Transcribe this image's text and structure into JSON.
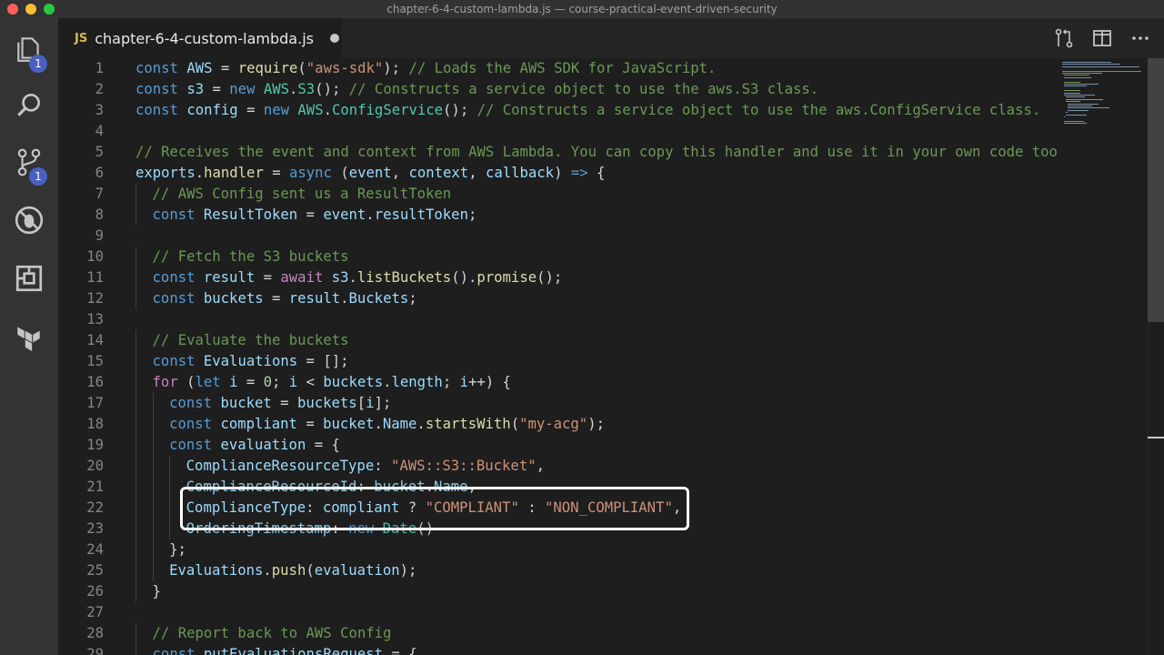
{
  "window": {
    "title": "chapter-6-4-custom-lambda.js — course-practical-event-driven-security"
  },
  "activity_bar": {
    "explorer_badge": "1",
    "source_control_badge": "1"
  },
  "tab": {
    "lang_badge": "JS",
    "filename": "chapter-6-4-custom-lambda.js"
  },
  "editor": {
    "line_numbers": [
      "1",
      "2",
      "3",
      "4",
      "5",
      "6",
      "7",
      "8",
      "9",
      "10",
      "11",
      "12",
      "13",
      "14",
      "15",
      "16",
      "17",
      "18",
      "19",
      "20",
      "21",
      "22",
      "23",
      "24",
      "25",
      "26",
      "27",
      "28",
      "29"
    ],
    "lines": [
      [
        "const",
        " ",
        "AWS",
        " = ",
        "require",
        "(",
        "\"aws-sdk\"",
        "); ",
        "// Loads the AWS SDK for JavaScript."
      ],
      [
        "const",
        " ",
        "s3",
        " = ",
        "new",
        " ",
        "AWS",
        ".",
        "S3",
        "(); ",
        "// Constructs a service object to use the aws.S3 class."
      ],
      [
        "const",
        " ",
        "config",
        " = ",
        "new",
        " ",
        "AWS",
        ".",
        "ConfigService",
        "(); ",
        "// Constructs a service object to use the aws.ConfigService class."
      ],
      [],
      [
        "// Receives the event and context from AWS Lambda. You can copy this handler and use it in your own code too!"
      ],
      [
        "exports",
        ".",
        "handler",
        " = ",
        "async",
        " (",
        "event",
        ", ",
        "context",
        ", ",
        "callback",
        ") ",
        "=>",
        " {"
      ],
      [
        "// AWS Config sent us a ResultToken"
      ],
      [
        "const",
        " ",
        "ResultToken",
        " = ",
        "event",
        ".",
        "resultToken",
        ";"
      ],
      [],
      [
        "// Fetch the S3 buckets"
      ],
      [
        "const",
        " ",
        "result",
        " = ",
        "await",
        " ",
        "s3",
        ".",
        "listBuckets",
        "().",
        "promise",
        "();"
      ],
      [
        "const",
        " ",
        "buckets",
        " = ",
        "result",
        ".",
        "Buckets",
        ";"
      ],
      [],
      [
        "// Evaluate the buckets"
      ],
      [
        "const",
        " ",
        "Evaluations",
        " = [];"
      ],
      [
        "for",
        " (",
        "let",
        " ",
        "i",
        " = ",
        "0",
        "; ",
        "i",
        " < ",
        "buckets",
        ".",
        "length",
        "; ",
        "i",
        "++) {"
      ],
      [
        "const",
        " ",
        "bucket",
        " = ",
        "buckets",
        "[",
        "i",
        "];"
      ],
      [
        "const",
        " ",
        "compliant",
        " = ",
        "bucket",
        ".",
        "Name",
        ".",
        "startsWith",
        "(",
        "\"my-acg\"",
        ");"
      ],
      [
        "const",
        " ",
        "evaluation",
        " = {"
      ],
      [
        "ComplianceResourceType",
        ": ",
        "\"AWS::S3::Bucket\"",
        ","
      ],
      [
        "ComplianceResourceId",
        ": ",
        "bucket",
        ".",
        "Name",
        ","
      ],
      [
        "ComplianceType",
        ": ",
        "compliant",
        " ? ",
        "\"COMPLIANT\"",
        " : ",
        "\"NON_COMPLIANT\"",
        ","
      ],
      [
        "OrderingTimestamp",
        ": ",
        "new",
        " ",
        "Date",
        "()"
      ],
      [
        "};"
      ],
      [
        "Evaluations",
        ".",
        "push",
        "(",
        "evaluation",
        ");"
      ],
      [
        "}"
      ],
      [],
      [
        "// Report back to AWS Config"
      ],
      [
        "const",
        " ",
        "putEvaluationsRequest",
        " = {"
      ]
    ]
  },
  "colors": {
    "keyword": "#569cd6",
    "control": "#c586c0",
    "variable": "#9cdcfe",
    "function": "#dcdcaa",
    "comment": "#6a9955",
    "string": "#ce9178",
    "number": "#b5cea8",
    "class": "#4ec9b0"
  }
}
